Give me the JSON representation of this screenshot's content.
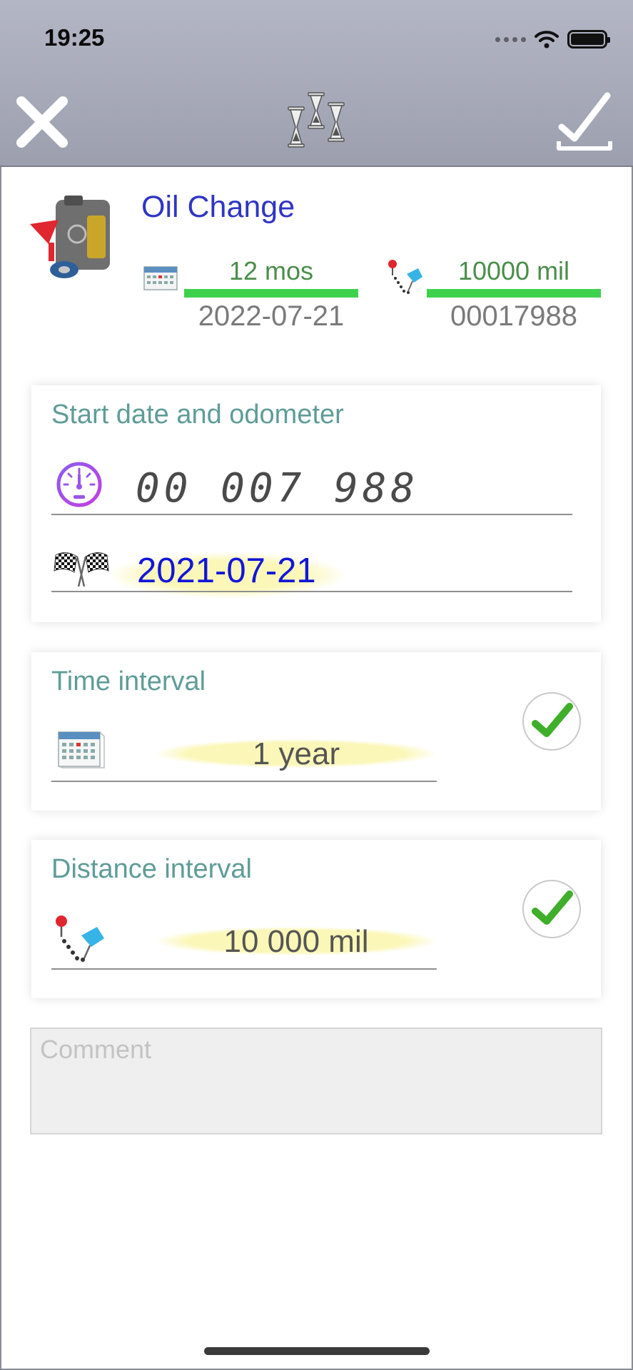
{
  "status_bar": {
    "time": "19:25"
  },
  "nav": {
    "close_icon": "close-x-icon",
    "title_icon": "hourglasses-icon",
    "done_icon": "checkmark-tray-icon"
  },
  "summary": {
    "title": "Oil Change",
    "time_interval_value": "12 mos",
    "time_due_date": "2022-07-21",
    "distance_interval_value": "10000 mil",
    "distance_due_odometer": "00017988",
    "bar_color": "#3ed24c"
  },
  "start_card": {
    "title": "Start date and odometer",
    "odometer_value": "00 007 988",
    "start_date": "2021-07-21"
  },
  "time_card": {
    "title": "Time interval",
    "value": "1 year",
    "enabled": true
  },
  "distance_card": {
    "title": "Distance interval",
    "value": "10 000 mil",
    "enabled": true
  },
  "comment": {
    "placeholder": "Comment",
    "value": ""
  },
  "colors": {
    "title_blue": "#2e35c4",
    "label_teal": "#5f9c98",
    "value_green": "#4b8d4b",
    "date_blue": "#1216d8",
    "check_green": "#3fae2a"
  }
}
